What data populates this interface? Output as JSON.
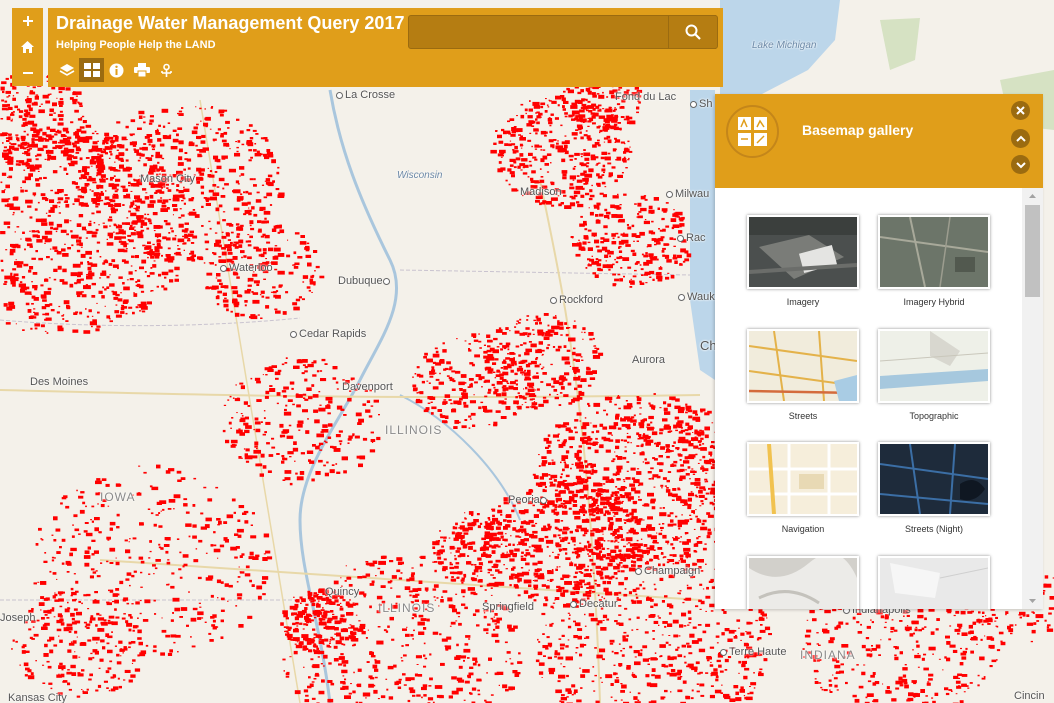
{
  "app": {
    "title": "Drainage Water Management Query 2017",
    "subtitle": "Helping People Help the LAND"
  },
  "search": {
    "value": "",
    "placeholder": ""
  },
  "zoom_controls": [
    "zoom-in",
    "home",
    "zoom-out"
  ],
  "toolbar": {
    "tools": [
      "layers-icon",
      "basemap-icon",
      "info-icon",
      "print-icon",
      "share-icon"
    ],
    "active": "basemap-icon"
  },
  "panel": {
    "title": "Basemap gallery",
    "basemaps": [
      {
        "label": "Imagery"
      },
      {
        "label": "Imagery Hybrid"
      },
      {
        "label": "Streets"
      },
      {
        "label": "Topographic"
      },
      {
        "label": "Navigation"
      },
      {
        "label": "Streets (Night)"
      },
      {
        "label": ""
      },
      {
        "label": ""
      }
    ]
  },
  "map": {
    "overlay_color": "#ff0000",
    "labels": {
      "lake_michigan": "Lake Michigan",
      "la_crosse": "La Crosse",
      "fond_du_lac": "Fond du Lac",
      "sheboygan": "Sh",
      "mason_city": "Mason City",
      "wisconsin": "Wisconsin",
      "madison": "Madison",
      "milwaukee": "Milwau",
      "racine": "Rac",
      "waterloo": "Waterloo",
      "dubuque": "Dubuque",
      "rockford": "Rockford",
      "waukegan": "Wauk",
      "cedar_rapids": "Cedar Rapids",
      "aurora": "Aurora",
      "chicago": "Ch",
      "des_moines": "Des Moines",
      "davenport": "Davenport",
      "illinois_river": "ILLINOIS",
      "iowa": "IOWA",
      "peoria": "Peoria",
      "quincy": "Quincy",
      "illinois": "ILLINOIS",
      "springfield": "Springfield",
      "decatur": "Decatur",
      "champaign": "Champaign",
      "indianapolis": "Indianapolis",
      "terre_haute": "Terre Haute",
      "indiana": "INDIANA",
      "joseph": "Joseph",
      "kansas_city": "Kansas City",
      "cincinnati": "Cincin"
    }
  },
  "colors": {
    "accent": "#e09e1a",
    "accent_dark": "#9b6b10"
  }
}
